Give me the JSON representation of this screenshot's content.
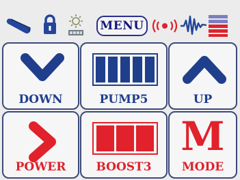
{
  "colors": {
    "blue": "#1f3f8c",
    "red": "#e1212b",
    "border": "#3b4a7a",
    "tile_bg": "#f6f6f6"
  },
  "status_bar": {
    "menu_label": "MENU",
    "icons": [
      "clip-icon",
      "lock-icon",
      "brightness-icon",
      "signal-icon",
      "pulse-icon",
      "battery-icon"
    ],
    "battery_level": "3 of 5 bars (red)"
  },
  "tiles": {
    "down": {
      "label": "DOWN",
      "icon": "chevron-down-icon"
    },
    "pump": {
      "label": "PUMP5",
      "icon": "pump-level-icon",
      "level": 5
    },
    "up": {
      "label": "UP",
      "icon": "chevron-up-icon"
    },
    "power": {
      "label": "POWER",
      "icon": "chevron-right-icon"
    },
    "boost": {
      "label": "BOOST3",
      "icon": "boost-level-icon",
      "level": 3
    },
    "mode": {
      "label": "MODE",
      "glyph": "M"
    }
  }
}
